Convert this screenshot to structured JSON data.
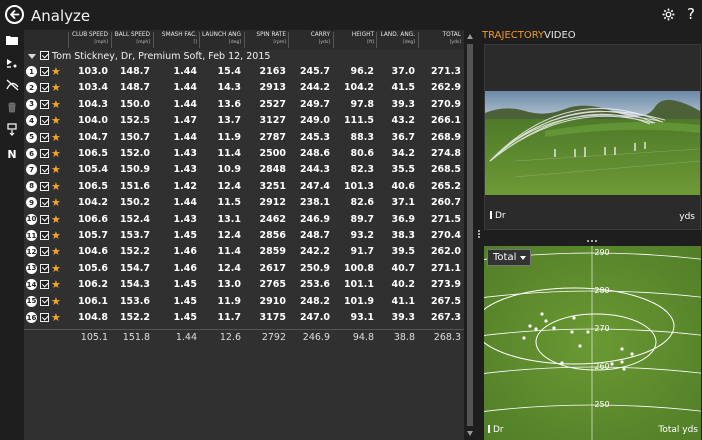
{
  "header": {
    "title": "Analyze",
    "back_icon": "arrow-left-circle-icon",
    "settings_icon": "gear-icon",
    "help_label": "?"
  },
  "rail": {
    "icons": [
      "folder-icon",
      "flag-filter-icon",
      "trajectory-off-icon",
      "trash-icon",
      "export-icon"
    ],
    "n_label": "N"
  },
  "table": {
    "columns": [
      {
        "label": "CLUB SPEED",
        "unit": "[mph]"
      },
      {
        "label": "BALL SPEED",
        "unit": "[mph]"
      },
      {
        "label": "SMASH FAC.",
        "unit": "[]"
      },
      {
        "label": "LAUNCH ANG",
        "unit": "[deg]"
      },
      {
        "label": "SPIN RATE",
        "unit": "[rpm]"
      },
      {
        "label": "CARRY",
        "unit": "[yds]"
      },
      {
        "label": "HEIGHT",
        "unit": "[ft]"
      },
      {
        "label": "LAND. ANG.",
        "unit": "[deg]"
      },
      {
        "label": "TOTAL",
        "unit": "[yds]"
      }
    ],
    "group_label": "Tom Stickney, Dr, Premium Soft, Feb 12, 2015",
    "rows": [
      {
        "n": "1",
        "v": [
          "103.0",
          "148.7",
          "1.44",
          "15.4",
          "2163",
          "245.7",
          "96.2",
          "37.0",
          "271.3"
        ]
      },
      {
        "n": "2",
        "v": [
          "103.4",
          "148.7",
          "1.44",
          "14.3",
          "2913",
          "244.2",
          "104.2",
          "41.5",
          "262.9"
        ]
      },
      {
        "n": "3",
        "v": [
          "104.3",
          "150.0",
          "1.44",
          "13.6",
          "2527",
          "249.7",
          "97.8",
          "39.3",
          "270.9"
        ]
      },
      {
        "n": "4",
        "v": [
          "104.0",
          "152.5",
          "1.47",
          "13.7",
          "3127",
          "249.0",
          "111.5",
          "43.2",
          "266.1"
        ]
      },
      {
        "n": "5",
        "v": [
          "104.7",
          "150.7",
          "1.44",
          "11.9",
          "2787",
          "245.3",
          "88.3",
          "36.7",
          "268.9"
        ]
      },
      {
        "n": "6",
        "v": [
          "106.5",
          "152.0",
          "1.43",
          "11.4",
          "2500",
          "248.6",
          "80.6",
          "34.2",
          "274.8"
        ]
      },
      {
        "n": "7",
        "v": [
          "105.4",
          "150.9",
          "1.43",
          "10.9",
          "2848",
          "244.3",
          "82.3",
          "35.5",
          "268.5"
        ]
      },
      {
        "n": "8",
        "v": [
          "106.5",
          "151.6",
          "1.42",
          "12.4",
          "3251",
          "247.4",
          "101.3",
          "40.6",
          "265.2"
        ]
      },
      {
        "n": "9",
        "v": [
          "104.2",
          "150.2",
          "1.44",
          "11.5",
          "2912",
          "238.1",
          "82.6",
          "37.1",
          "260.7"
        ]
      },
      {
        "n": "10",
        "v": [
          "106.6",
          "152.4",
          "1.43",
          "13.1",
          "2462",
          "246.9",
          "89.7",
          "36.9",
          "271.5"
        ]
      },
      {
        "n": "11",
        "v": [
          "105.7",
          "153.7",
          "1.45",
          "12.4",
          "2856",
          "248.7",
          "93.2",
          "38.3",
          "270.4"
        ]
      },
      {
        "n": "12",
        "v": [
          "104.6",
          "152.2",
          "1.46",
          "11.4",
          "2859",
          "242.2",
          "91.7",
          "39.5",
          "262.0"
        ]
      },
      {
        "n": "13",
        "v": [
          "105.6",
          "154.7",
          "1.46",
          "12.4",
          "2617",
          "250.9",
          "100.8",
          "40.7",
          "271.1"
        ]
      },
      {
        "n": "14",
        "v": [
          "106.2",
          "154.3",
          "1.45",
          "13.0",
          "2765",
          "253.6",
          "101.1",
          "40.2",
          "273.9"
        ]
      },
      {
        "n": "15",
        "v": [
          "106.1",
          "153.6",
          "1.45",
          "11.9",
          "2910",
          "248.2",
          "101.9",
          "41.1",
          "267.5"
        ]
      },
      {
        "n": "16",
        "v": [
          "104.8",
          "152.2",
          "1.45",
          "11.7",
          "3175",
          "247.0",
          "93.1",
          "39.3",
          "267.3"
        ]
      }
    ],
    "summary": [
      "105.1",
      "151.8",
      "1.44",
      "12.6",
      "2792",
      "246.9",
      "94.8",
      "38.8",
      "268.3"
    ]
  },
  "right": {
    "tabs": [
      "TRAJECTORY",
      "VIDEO"
    ],
    "trajectory": {
      "club": "Dr",
      "unit": "yds"
    },
    "dispersion": {
      "dropdown_value": "Total",
      "ring_labels": [
        "290",
        "280",
        "270",
        "260",
        "250"
      ],
      "club": "Dr",
      "footer_label": "Total yds"
    }
  },
  "colors": {
    "accent": "#f39a1e",
    "star": "#f5a623",
    "grass": "#5f8a2c"
  }
}
